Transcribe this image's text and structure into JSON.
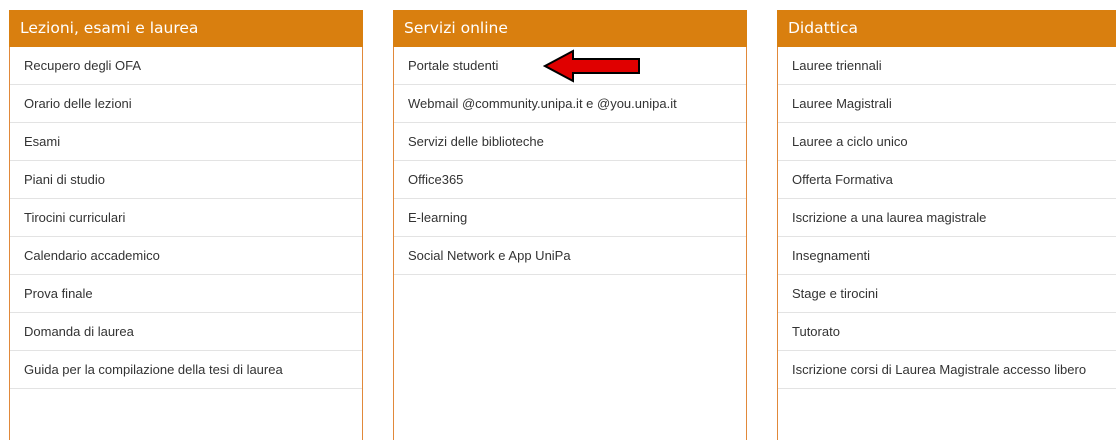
{
  "panels": [
    {
      "title": "Lezioni, esami e laurea",
      "items": [
        "Recupero degli OFA",
        "Orario delle lezioni",
        "Esami",
        "Piani di studio",
        "Tirocini curriculari",
        "Calendario accademico",
        "Prova finale",
        "Domanda di laurea",
        "Guida per la compilazione della tesi di laurea"
      ]
    },
    {
      "title": "Servizi online",
      "items": [
        "Portale studenti",
        "Webmail @community.unipa.it e @you.unipa.it",
        "Servizi delle biblioteche",
        "Office365",
        "E-learning",
        "Social Network e App UniPa"
      ]
    },
    {
      "title": "Didattica",
      "items": [
        "Lauree triennali",
        "Lauree Magistrali",
        "Lauree a ciclo unico",
        "Offerta Formativa",
        "Iscrizione a una laurea magistrale",
        "Insegnamenti",
        "Stage e tirocini",
        "Tutorato",
        "Iscrizione corsi di Laurea Magistrale accesso libero"
      ]
    }
  ],
  "colors": {
    "header": "#d97f0f",
    "border": "#e1893a",
    "arrow_fill": "#e00000"
  },
  "annotation": {
    "icon": "red-arrow-left-icon"
  }
}
